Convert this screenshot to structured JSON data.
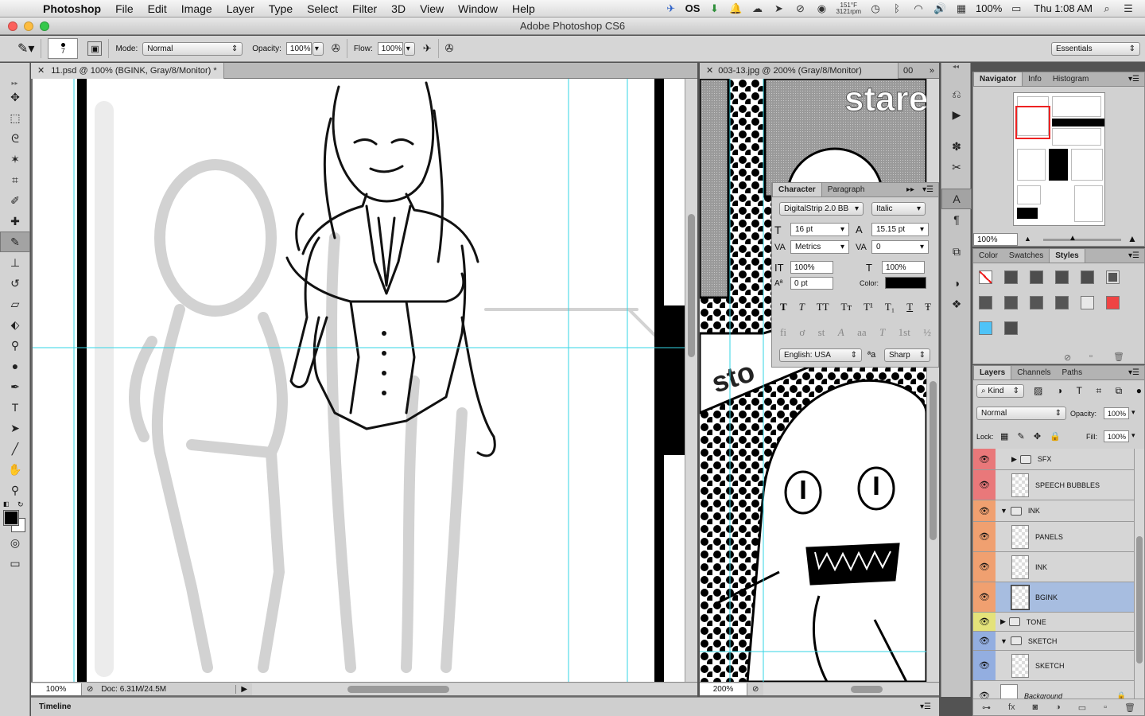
{
  "menubar": {
    "app_name": "Photoshop",
    "items": [
      "File",
      "Edit",
      "Image",
      "Layer",
      "Type",
      "Select",
      "Filter",
      "3D",
      "View",
      "Window",
      "Help"
    ],
    "status": {
      "temp": "151°F",
      "rpm": "3121rpm",
      "battery": "100%",
      "clock": "Thu 1:08 AM",
      "os_badge": "OS"
    }
  },
  "window": {
    "title": "Adobe Photoshop CS6"
  },
  "options": {
    "brush_size": "7",
    "mode_label": "Mode:",
    "mode_value": "Normal",
    "opacity_label": "Opacity:",
    "opacity_value": "100%",
    "flow_label": "Flow:",
    "flow_value": "100%",
    "workspace": "Essentials"
  },
  "doc1": {
    "tab": "11.psd @ 100% (BGINK, Gray/8/Monitor) *",
    "zoom": "100%",
    "doc_info": "Doc: 6.31M/24.5M"
  },
  "doc2": {
    "tab": "003-13.jpg @ 200% (Gray/8/Monitor)",
    "tab_more": "00",
    "zoom": "200%",
    "canvas_text_1": "stare",
    "canvas_text_2": "sto"
  },
  "navigator": {
    "tabs": [
      "Navigator",
      "Info",
      "Histogram"
    ],
    "zoom": "100%"
  },
  "color_panel": {
    "tabs": [
      "Color",
      "Swatches",
      "Styles"
    ]
  },
  "character": {
    "tabs": [
      "Character",
      "Paragraph"
    ],
    "font_family": "DigitalStrip 2.0 BB",
    "font_style": "Italic",
    "size": "16 pt",
    "leading": "15.15 pt",
    "kerning": "Metrics",
    "tracking": "0",
    "vscale": "100%",
    "hscale": "100%",
    "baseline": "0 pt",
    "color_label": "Color:",
    "language": "English: USA",
    "aa_label": "ªa",
    "antialias": "Sharp",
    "style_glyphs": [
      "T",
      "T",
      "TT",
      "Tт",
      "T¹",
      "T₁",
      "T",
      "Ŧ"
    ],
    "opentype_glyphs": [
      "fi",
      "ơ",
      "st",
      "A",
      "aa",
      "T",
      "1st",
      "½"
    ]
  },
  "layers": {
    "tabs": [
      "Layers",
      "Channels",
      "Paths"
    ],
    "kind": "Kind",
    "blend": "Normal",
    "opacity_label": "Opacity:",
    "opacity": "100%",
    "lock_label": "Lock:",
    "fill_label": "Fill:",
    "fill": "100%",
    "items": [
      {
        "name": "SFX",
        "type": "group"
      },
      {
        "name": "SPEECH BUBBLES",
        "type": "layer"
      },
      {
        "name": "INK",
        "type": "group"
      },
      {
        "name": "PANELS",
        "type": "layer"
      },
      {
        "name": "INK",
        "type": "layer"
      },
      {
        "name": "BGINK",
        "type": "layer"
      },
      {
        "name": "TONE",
        "type": "group"
      },
      {
        "name": "SKETCH",
        "type": "group"
      },
      {
        "name": "SKETCH",
        "type": "layer"
      },
      {
        "name": "Background",
        "type": "layer"
      }
    ]
  },
  "timeline": {
    "label": "Timeline"
  },
  "colors": {
    "accent_selected": "#a7bde0",
    "red_label": "#e9787a",
    "orange_label": "#f0a070",
    "yellow_label": "#e4e27a",
    "blue_label": "#93aee0",
    "guide": "#33d6e6"
  }
}
